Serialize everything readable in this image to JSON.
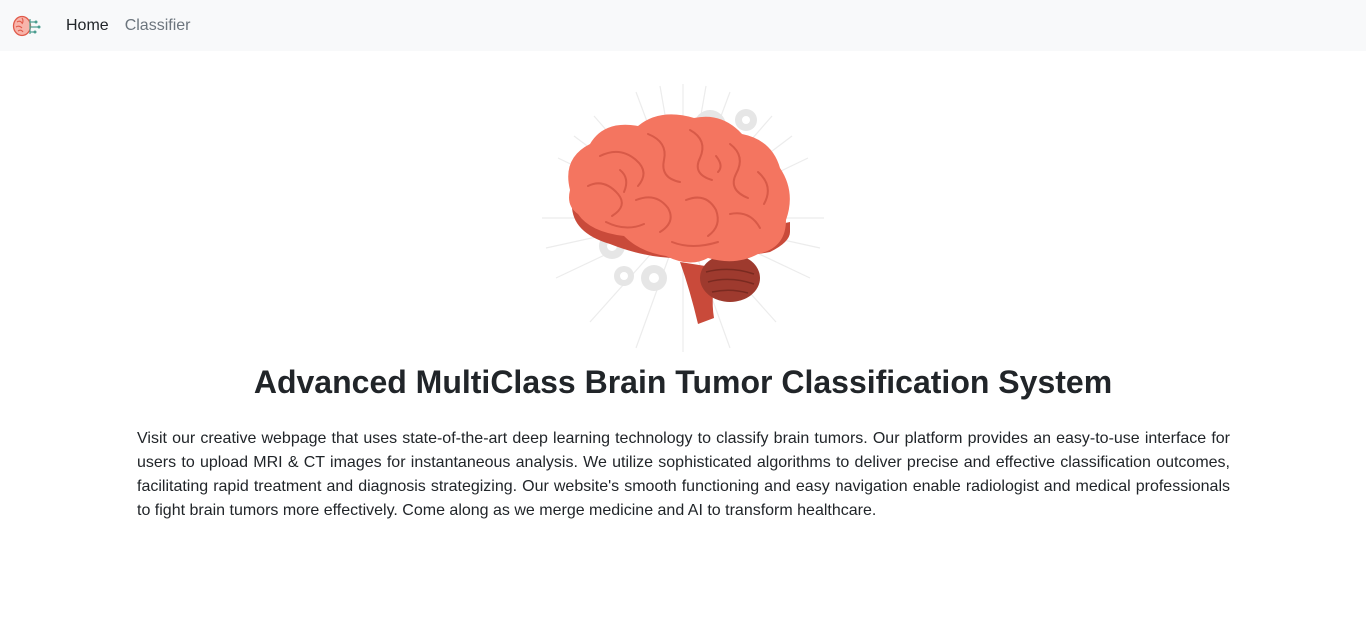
{
  "navbar": {
    "logo_icon": "brain-circuit-icon",
    "links": [
      {
        "label": "Home",
        "active": true
      },
      {
        "label": "Classifier",
        "active": false
      }
    ]
  },
  "hero": {
    "image_icon": "brain-illustration",
    "title": "Advanced MultiClass Brain Tumor Classification System",
    "description": "Visit our creative webpage that uses state-of-the-art deep learning technology to classify brain tumors. Our platform provides an easy-to-use interface for users to upload MRI & CT images for instantaneous analysis. We utilize sophisticated algorithms to deliver precise and effective classification outcomes, facilitating rapid treatment and diagnosis strategizing. Our website's smooth functioning and easy navigation enable radiologist and medical professionals to fight brain tumors more effectively. Come along as we merge medicine and AI to transform healthcare."
  },
  "colors": {
    "navbar_bg": "#f8f9fa",
    "brain": "#f47560",
    "brain_dark": "#c94a3a",
    "gear": "#e0e0e0",
    "text": "#212529",
    "muted": "#6c757d"
  }
}
